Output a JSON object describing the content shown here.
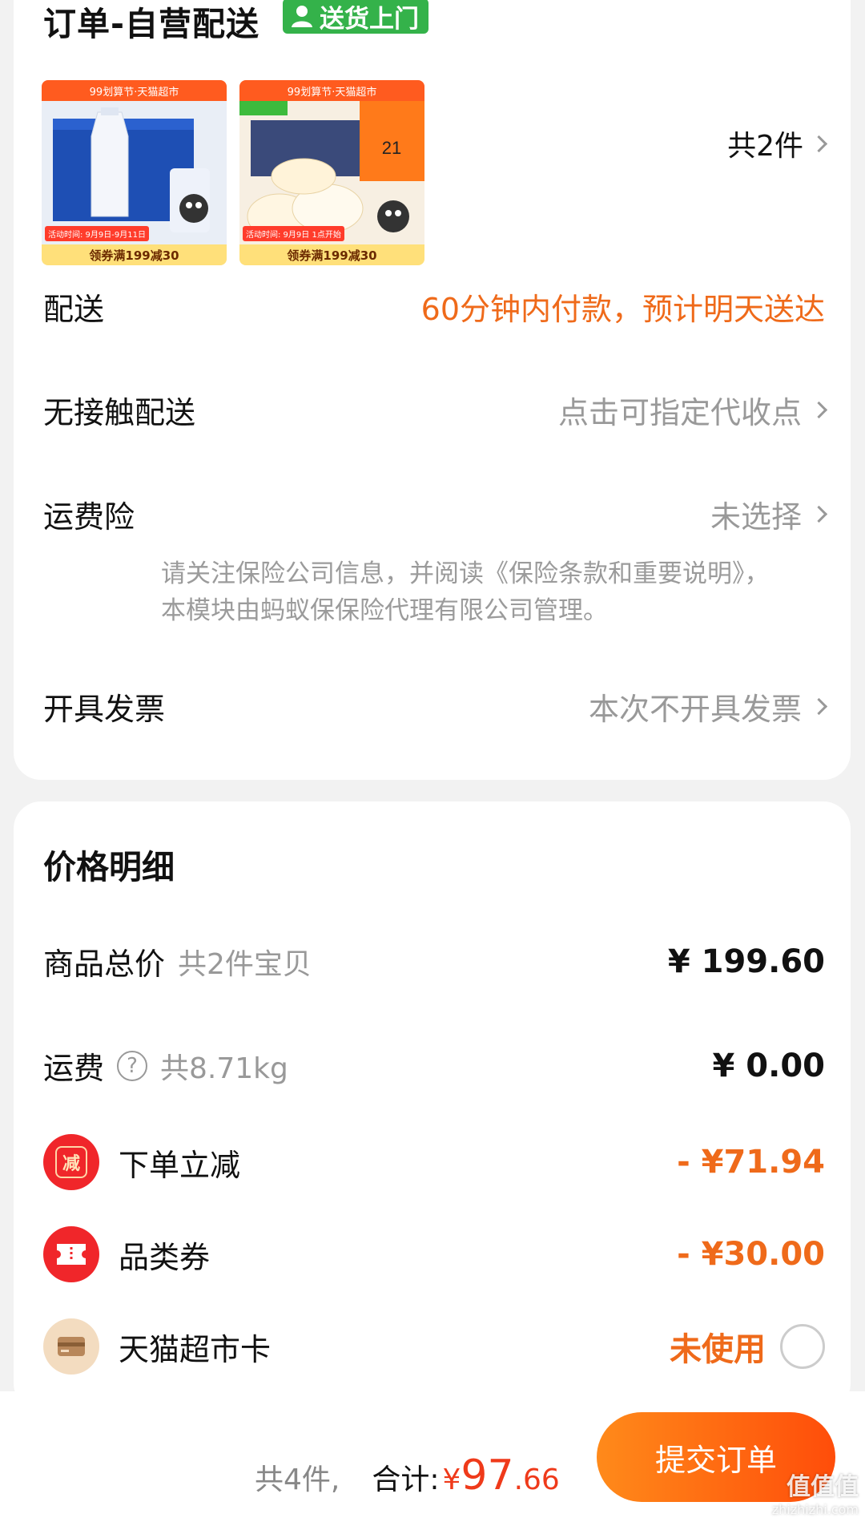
{
  "order": {
    "title": "订单-自营配送",
    "delivery_badge": "送货上门",
    "products": [
      {
        "name": "product-1",
        "top_banner": "99划算节·天猫超市",
        "promo": "领券满199减30",
        "date": "活动时间: 9月9日-9月11日"
      },
      {
        "name": "product-2",
        "top_banner": "99划算节·天猫超市",
        "promo": "领券满199减30",
        "date": "活动时间: 9月9日 1点开始"
      }
    ],
    "item_count": "共2件",
    "rows": {
      "delivery": {
        "label": "配送",
        "value": "60分钟内付款，预计明天送达"
      },
      "contactless": {
        "label": "无接触配送",
        "value": "点击可指定代收点"
      },
      "insurance": {
        "label": "运费险",
        "value": "未选择",
        "note": "请关注保险公司信息，并阅读《保险条款和重要说明》，本模块由蚂蚁保保险代理有限公司管理。"
      },
      "invoice": {
        "label": "开具发票",
        "value": "本次不开具发票"
      }
    }
  },
  "price": {
    "title": "价格明细",
    "total": {
      "label": "商品总价",
      "sub": "共2件宝贝",
      "amount": "¥ 199.60"
    },
    "shipping": {
      "label": "运费",
      "sub": "共8.71kg",
      "amount": "¥ 0.00"
    },
    "instant": {
      "label": "下单立减",
      "icon_text": "减",
      "amount": "- ¥71.94"
    },
    "coupon": {
      "label": "品类券",
      "amount": "- ¥30.00"
    },
    "card": {
      "label": "天猫超市卡",
      "status": "未使用"
    }
  },
  "bottom": {
    "count": "共4件,",
    "total_label": "合计:",
    "currency": "¥",
    "amount_int": "97",
    "amount_dec": ".66",
    "submit": "提交订单"
  },
  "watermark": {
    "text": "值值值",
    "url": "zhizhizhi.com"
  },
  "colors": {
    "accent": "#ef6a1a",
    "badge_green": "#34b24a",
    "red_icon": "#f0262a"
  }
}
